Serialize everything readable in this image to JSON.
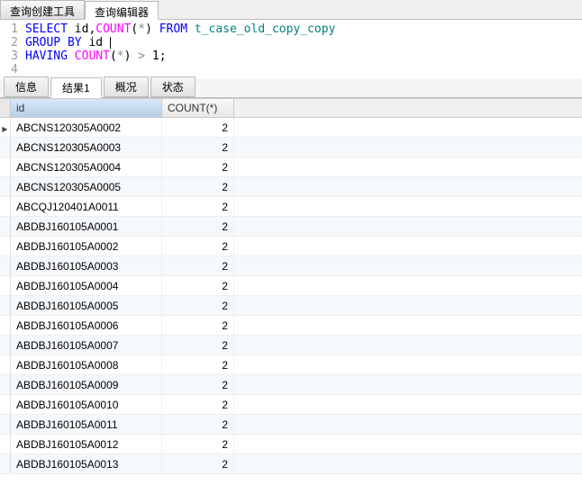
{
  "top_tabs": {
    "builder": "查询创建工具",
    "editor": "查询编辑器"
  },
  "sql": {
    "lines": [
      {
        "n": "1",
        "parts": [
          {
            "t": "SELECT",
            "c": "kw"
          },
          {
            "t": " "
          },
          {
            "t": "id"
          },
          {
            "t": ","
          },
          {
            "t": "COUNT",
            "c": "func"
          },
          {
            "t": "("
          },
          {
            "t": "*",
            "c": "op"
          },
          {
            "t": ")"
          },
          {
            "t": " "
          },
          {
            "t": "FROM",
            "c": "kw"
          },
          {
            "t": " "
          },
          {
            "t": "t_case_old_copy_copy",
            "c": "tbl"
          }
        ]
      },
      {
        "n": "2",
        "parts": [
          {
            "t": "GROUP BY",
            "c": "kw"
          },
          {
            "t": " "
          },
          {
            "t": "id"
          },
          {
            "t": " ",
            "cursor": true
          }
        ]
      },
      {
        "n": "3",
        "parts": [
          {
            "t": "HAVING",
            "c": "kw"
          },
          {
            "t": " "
          },
          {
            "t": "COUNT",
            "c": "func"
          },
          {
            "t": "("
          },
          {
            "t": "*",
            "c": "op"
          },
          {
            "t": ")"
          },
          {
            "t": " "
          },
          {
            "t": ">",
            "c": "op"
          },
          {
            "t": " "
          },
          {
            "t": "1",
            "c": "num"
          },
          {
            "t": ";"
          }
        ]
      },
      {
        "n": "4",
        "parts": []
      }
    ]
  },
  "result_tabs": {
    "info": "信息",
    "result1": "结果1",
    "profile": "概况",
    "status": "状态"
  },
  "columns": {
    "id": "id",
    "count": "COUNT(*)"
  },
  "chart_data": {
    "type": "table",
    "columns": [
      "id",
      "COUNT(*)"
    ],
    "rows": [
      {
        "id": "ABCNS120305A0002",
        "count": 2,
        "current": true
      },
      {
        "id": "ABCNS120305A0003",
        "count": 2
      },
      {
        "id": "ABCNS120305A0004",
        "count": 2
      },
      {
        "id": "ABCNS120305A0005",
        "count": 2
      },
      {
        "id": "ABCQJ120401A0011",
        "count": 2
      },
      {
        "id": "ABDBJ160105A0001",
        "count": 2
      },
      {
        "id": "ABDBJ160105A0002",
        "count": 2
      },
      {
        "id": "ABDBJ160105A0003",
        "count": 2
      },
      {
        "id": "ABDBJ160105A0004",
        "count": 2
      },
      {
        "id": "ABDBJ160105A0005",
        "count": 2
      },
      {
        "id": "ABDBJ160105A0006",
        "count": 2
      },
      {
        "id": "ABDBJ160105A0007",
        "count": 2
      },
      {
        "id": "ABDBJ160105A0008",
        "count": 2
      },
      {
        "id": "ABDBJ160105A0009",
        "count": 2
      },
      {
        "id": "ABDBJ160105A0010",
        "count": 2
      },
      {
        "id": "ABDBJ160105A0011",
        "count": 2
      },
      {
        "id": "ABDBJ160105A0012",
        "count": 2
      },
      {
        "id": "ABDBJ160105A0013",
        "count": 2
      }
    ]
  }
}
